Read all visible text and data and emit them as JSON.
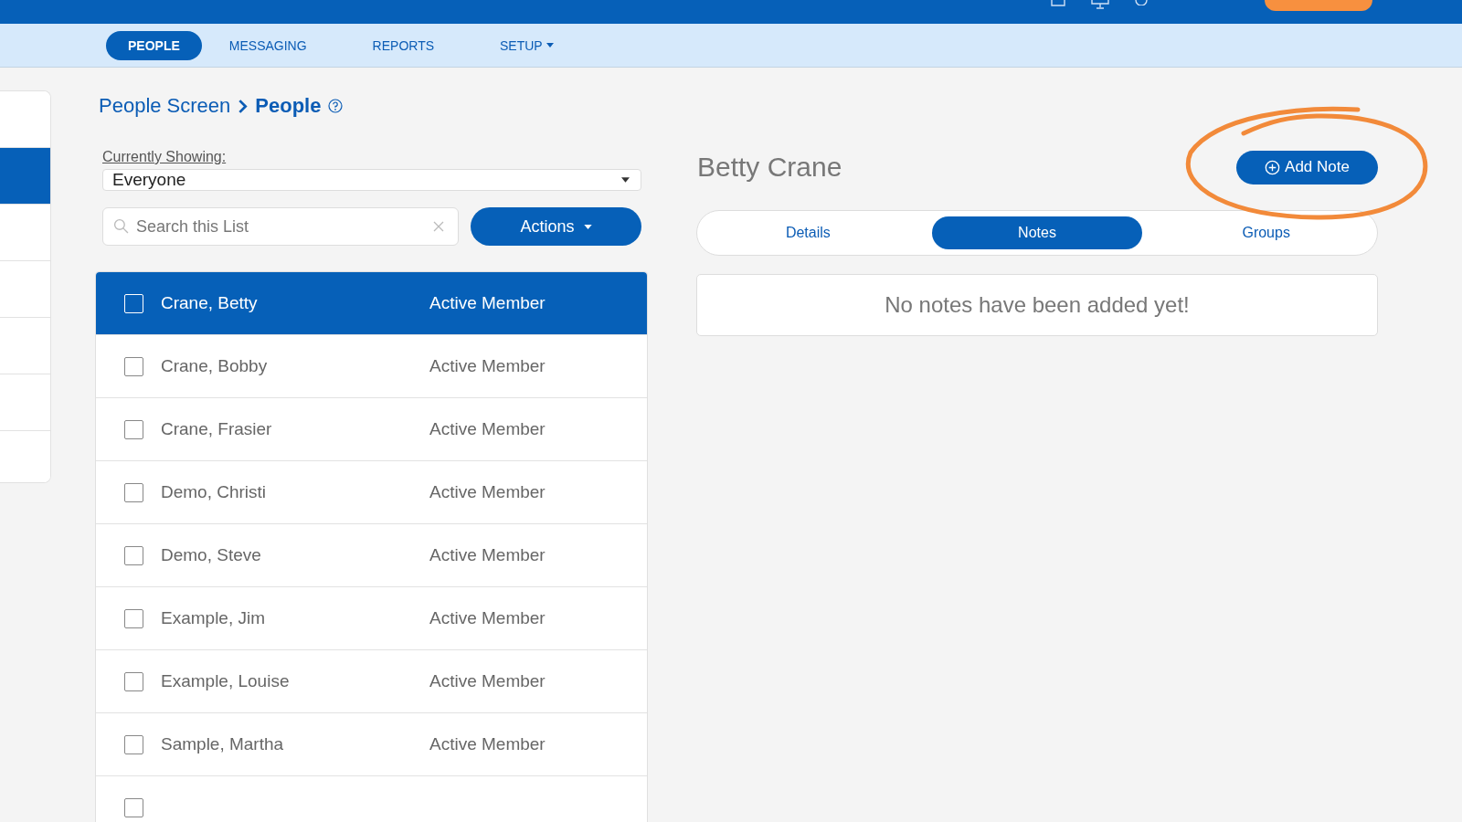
{
  "nav": {
    "tabs": [
      {
        "label": "PEOPLE",
        "selected": true,
        "dropdown": false
      },
      {
        "label": "MESSAGING",
        "selected": false,
        "dropdown": false
      },
      {
        "label": "REPORTS",
        "selected": false,
        "dropdown": false
      },
      {
        "label": "SETUP",
        "selected": false,
        "dropdown": true
      }
    ]
  },
  "sidebar": {
    "items": [
      {
        "selected": false
      },
      {
        "selected": true
      },
      {
        "selected": false
      },
      {
        "selected": false
      },
      {
        "selected": false
      },
      {
        "selected": false
      },
      {
        "selected": false
      }
    ]
  },
  "breadcrumb": {
    "parent": "People Screen",
    "current": "People"
  },
  "filter": {
    "label": "Currently Showing:",
    "value": "Everyone"
  },
  "search": {
    "placeholder": "Search this List"
  },
  "actions_button": "Actions",
  "people": [
    {
      "name": "Crane, Betty",
      "status": "Active Member",
      "checked": false,
      "selected": true
    },
    {
      "name": "Crane, Bobby",
      "status": "Active Member",
      "checked": false,
      "selected": false
    },
    {
      "name": "Crane, Frasier",
      "status": "Active Member",
      "checked": false,
      "selected": false
    },
    {
      "name": "Demo, Christi",
      "status": "Active Member",
      "checked": false,
      "selected": false
    },
    {
      "name": "Demo, Steve",
      "status": "Active Member",
      "checked": false,
      "selected": false
    },
    {
      "name": "Example, Jim",
      "status": "Active Member",
      "checked": false,
      "selected": false
    },
    {
      "name": "Example, Louise",
      "status": "Active Member",
      "checked": false,
      "selected": false
    },
    {
      "name": "Sample, Martha",
      "status": "Active Member",
      "checked": false,
      "selected": false
    },
    {
      "checked": false,
      "selected": false
    }
  ],
  "detail": {
    "name": "Betty Crane",
    "add_button": "Add Note",
    "tabs": [
      {
        "label": "Details",
        "selected": false
      },
      {
        "label": "Notes",
        "selected": true
      },
      {
        "label": "Groups",
        "selected": false
      }
    ],
    "empty_message": "No notes have been added yet!"
  }
}
